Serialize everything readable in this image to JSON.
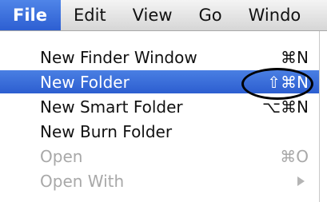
{
  "menubar": {
    "items": [
      {
        "label": "File"
      },
      {
        "label": "Edit"
      },
      {
        "label": "View"
      },
      {
        "label": "Go"
      },
      {
        "label": "Windo"
      }
    ]
  },
  "menu": {
    "items": [
      {
        "label": "New Finder Window",
        "shortcut": "⌘N"
      },
      {
        "label": "New Folder",
        "shortcut": "⇧⌘N"
      },
      {
        "label": "New Smart Folder",
        "shortcut": "⌥⌘N"
      },
      {
        "label": "New Burn Folder",
        "shortcut": ""
      },
      {
        "label": "Open",
        "shortcut": "⌘O"
      },
      {
        "label": "Open With",
        "shortcut": ""
      }
    ]
  },
  "colors": {
    "highlight": "#3a6fdc",
    "disabled_text": "#a8a8a8",
    "annotation": "#000000"
  }
}
